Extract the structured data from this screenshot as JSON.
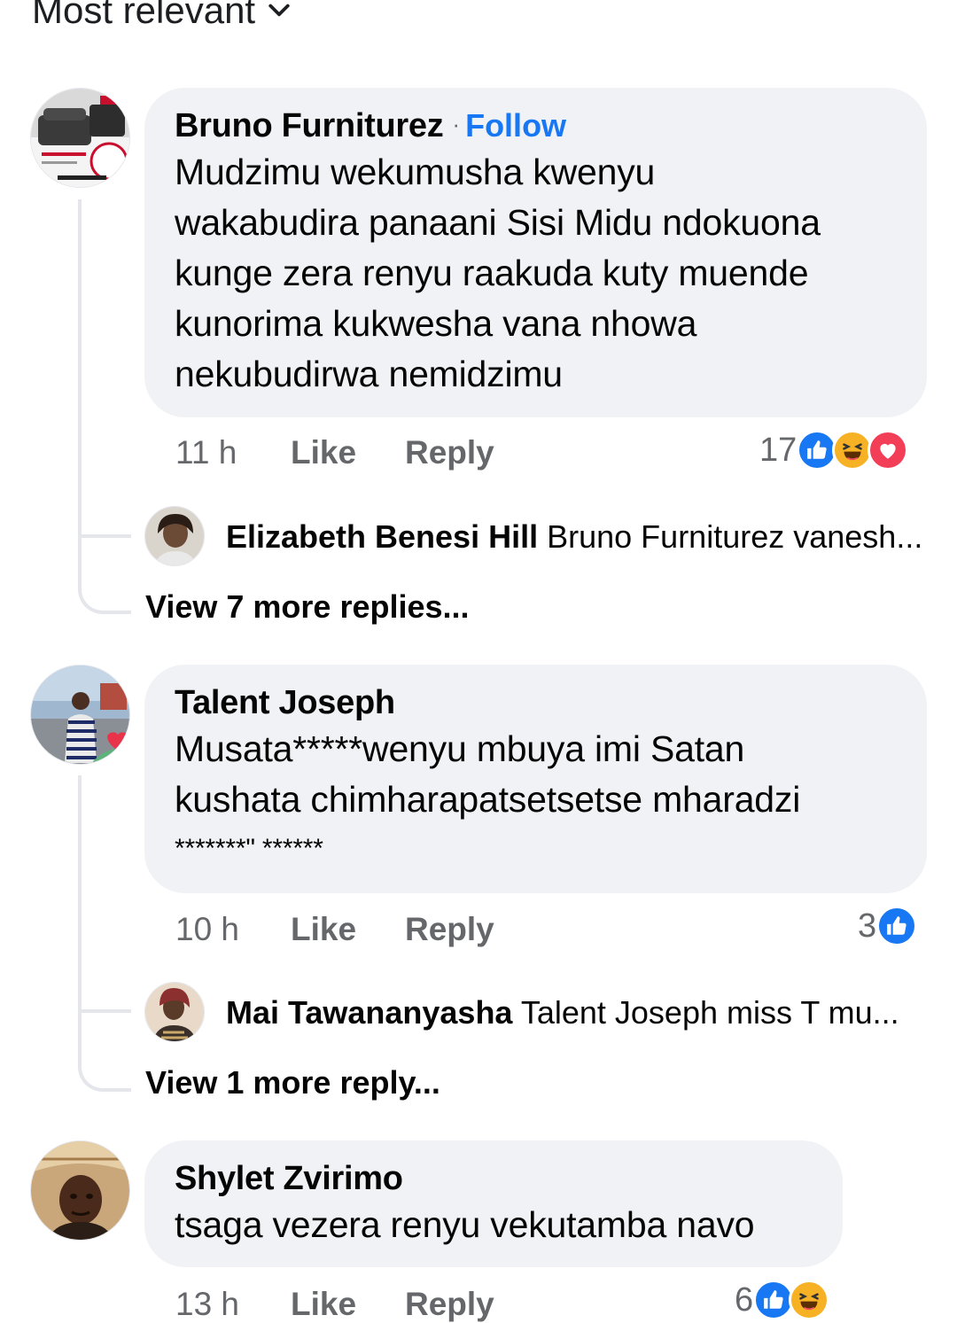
{
  "sort": {
    "label": "Most relevant"
  },
  "colors": {
    "link_blue": "#1877f2",
    "bubble_bg": "#f0f2f5",
    "meta_gray": "#65676b",
    "like_blue": "#1877f2",
    "haha_yellow": "#f7b125",
    "love_red": "#f33e58"
  },
  "comments": [
    {
      "author": "Bruno Furniturez",
      "follow": "Follow",
      "text_lines": [
        "Mudzimu wekumusha kwenyu",
        "wakabudira panaani Sisi Midu ndokuona",
        "kunge zera renyu raakuda kuty muende",
        "kunorima kukwesha vana nhowa",
        "nekubudirwa nemidzimu"
      ],
      "time": "11 h",
      "like": "Like",
      "reply": "Reply",
      "reaction_count": "17",
      "reactions": [
        "like-icon",
        "haha-icon",
        "love-icon"
      ],
      "reply_preview": {
        "name": "Elizabeth Benesi Hill",
        "text": "Bruno Furniturez vanesh..."
      },
      "more_replies": "View 7 more replies..."
    },
    {
      "author": "Talent Joseph",
      "text_lines": [
        "Musata*****wenyu mbuya imi Satan",
        "kushata chimharapatsetsetse mharadzi",
        "*******\" ******"
      ],
      "time": "10 h",
      "like": "Like",
      "reply": "Reply",
      "reaction_count": "3",
      "reactions": [
        "like-icon"
      ],
      "reply_preview": {
        "name": "Mai Tawananyasha",
        "text": "Talent Joseph  miss T mu..."
      },
      "more_replies": "View 1 more reply..."
    },
    {
      "author": "Shylet Zvirimo",
      "text_lines": [
        "tsaga vezera renyu vekutamba navo"
      ],
      "time": "13 h",
      "like": "Like",
      "reply": "Reply",
      "reaction_count": "6",
      "reactions": [
        "like-icon",
        "haha-icon"
      ]
    }
  ]
}
